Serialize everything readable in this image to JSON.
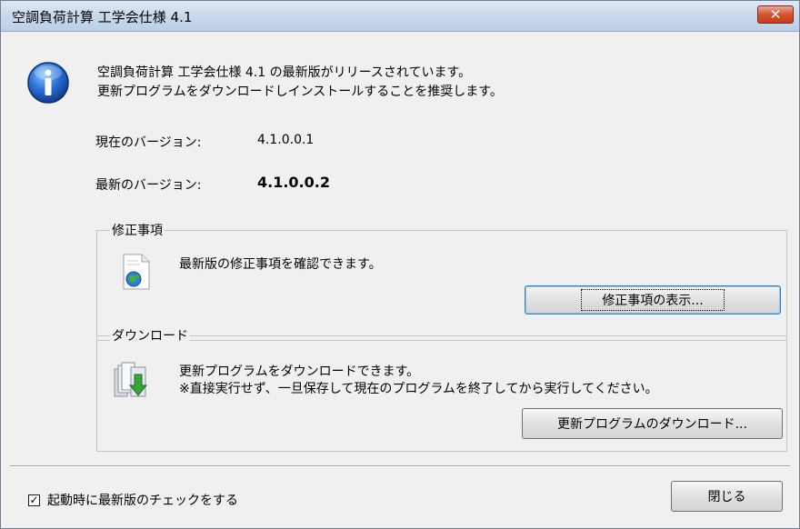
{
  "window": {
    "title": "空調負荷計算 工学会仕様 4.1",
    "close_symbol": "✕"
  },
  "message": {
    "line1": "空調負荷計算 工学会仕様 4.1 の最新版がリリースされています。",
    "line2": "更新プログラムをダウンロードしインストールすることを推奨します。"
  },
  "versions": {
    "current_label": "現在のバージョン:",
    "current_value": "4.1.0.0.1",
    "latest_label": "最新のバージョン:",
    "latest_value": "4.1.0.0.2"
  },
  "changes_group": {
    "legend": "修正事項",
    "text": "最新版の修正事項を確認できます。",
    "button_label": "修正事項の表示..."
  },
  "download_group": {
    "legend": "ダウンロード",
    "line1": "更新プログラムをダウンロードできます。",
    "line2": "※直接実行せず、一旦保存して現在のプログラムを終了してから実行してください。",
    "button_label": "更新プログラムのダウンロード..."
  },
  "footer": {
    "checkbox_label": "起動時に最新版のチェックをする",
    "checkbox_checked": true,
    "checkbox_mark": "✓",
    "close_button_label": "閉じる"
  }
}
